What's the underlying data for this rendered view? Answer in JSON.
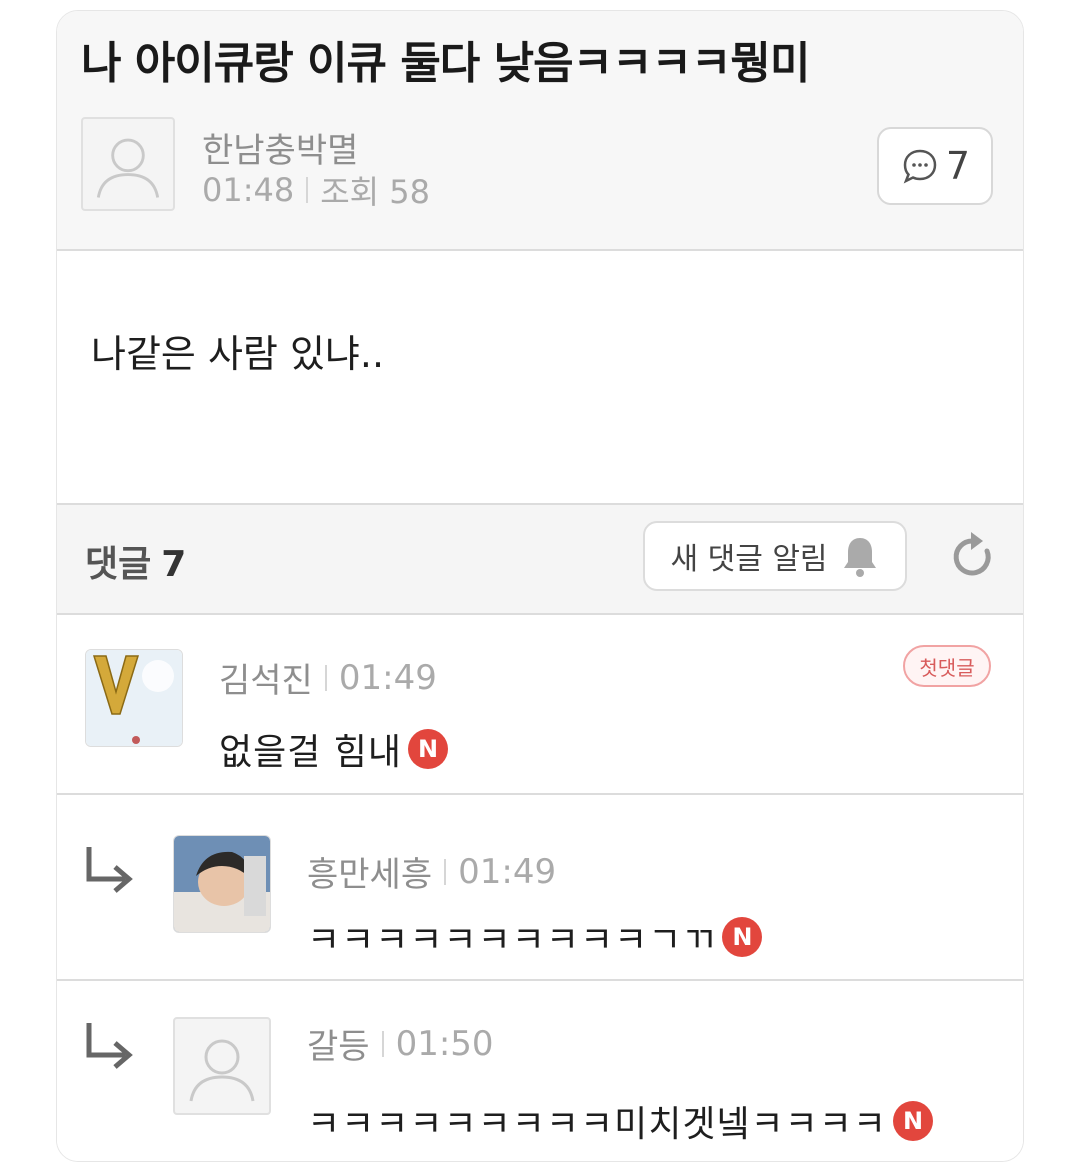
{
  "post": {
    "title": "나 아이큐랑 이큐 둘다 낮음ㅋㅋㅋㅋ뭥미",
    "author": "한남충박멸",
    "time": "01:48",
    "views_label": "조회 58",
    "comment_count": "7",
    "body": "나같은 사람 있냐.."
  },
  "comments_header": {
    "label": "댓글",
    "count": "7",
    "notify_label": "새 댓글 알림"
  },
  "comments": [
    {
      "author": "김석진",
      "time": "01:49",
      "text": "없을걸 힘내",
      "badge": "N",
      "first_label": "첫댓글"
    },
    {
      "author": "흥만세흥",
      "time": "01:49",
      "text": "ㅋㅋㅋㅋㅋㅋㅋㅋㅋㅋㄱㄲ",
      "badge": "N"
    },
    {
      "author": "갈등",
      "time": "01:50",
      "text": "ㅋㅋㅋㅋㅋㅋㅋㅋㅋ미치겟넼ㅋㅋㅋㅋ",
      "badge": "N"
    }
  ],
  "colors": {
    "new_badge": "#e2463d",
    "first_badge": "#d85b5b"
  }
}
